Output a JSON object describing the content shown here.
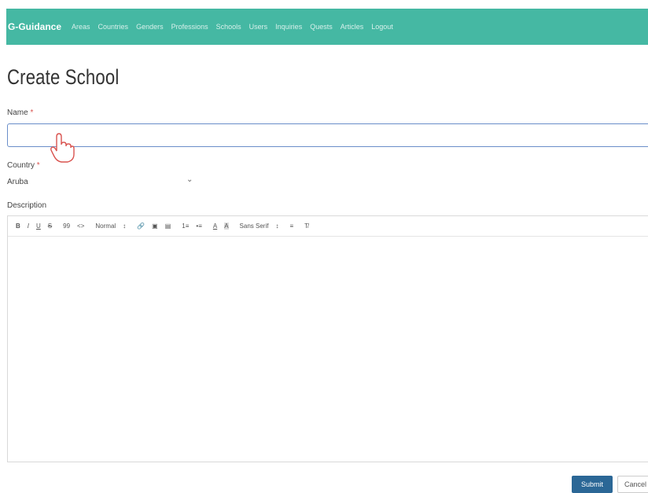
{
  "nav": {
    "brand": "G-Guidance",
    "links": [
      "Areas",
      "Countries",
      "Genders",
      "Professions",
      "Schools",
      "Users",
      "Inquiries",
      "Quests",
      "Articles",
      "Logout"
    ]
  },
  "page": {
    "title": "Create School"
  },
  "form": {
    "name_label": "Name",
    "name_value": "",
    "country_label": "Country",
    "country_value": "Aruba",
    "description_label": "Description",
    "required_mark": "*"
  },
  "toolbar": {
    "bold": "B",
    "italic": "I",
    "underline": "U",
    "strike": "S",
    "blockquote": "99",
    "code": "<>",
    "heading": "Normal",
    "heading_arrow": "↕",
    "link": "🔗",
    "image": "▣",
    "video": "▤",
    "ordered_list": "1≡",
    "bullet_list": "•≡",
    "text_color": "A",
    "background": "A",
    "font": "Sans Serif",
    "font_arrow": "↕",
    "align": "≡",
    "clean": "T̸"
  },
  "actions": {
    "submit": "Submit",
    "cancel": "Cancel"
  },
  "colors": {
    "navbar": "#45b8a3",
    "submit": "#2b6796",
    "input_border": "#6a8ec9"
  }
}
